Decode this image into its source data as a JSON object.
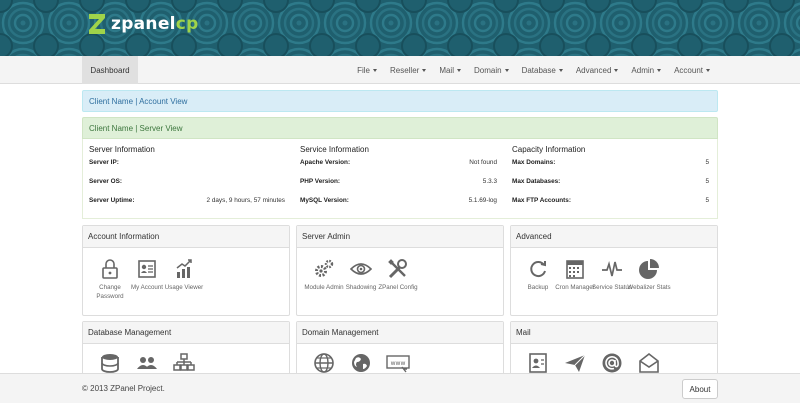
{
  "brand": {
    "name_main": "zpanel",
    "name_accent": "cp"
  },
  "nav": {
    "dashboard": "Dashboard",
    "menus": [
      "File",
      "Reseller",
      "Mail",
      "Domain",
      "Database",
      "Advanced",
      "Admin",
      "Account"
    ]
  },
  "alerts": {
    "client_account": "Client Name | Account View",
    "client_server": "Client Name | Server View"
  },
  "server_info": {
    "title": "Server Information",
    "rows": [
      {
        "label": "Server IP:",
        "value": ""
      },
      {
        "label": "Server OS:",
        "value": ""
      },
      {
        "label": "Server Uptime:",
        "value": "2 days, 9 hours, 57 minutes"
      }
    ]
  },
  "service_info": {
    "title": "Service Information",
    "rows": [
      {
        "label": "Apache Version:",
        "value": "Not found"
      },
      {
        "label": "PHP Version:",
        "value": "5.3.3"
      },
      {
        "label": "MySQL Version:",
        "value": "5.1.69-log"
      }
    ]
  },
  "capacity_info": {
    "title": "Capacity Information",
    "rows": [
      {
        "label": "Max Domains:",
        "value": "5"
      },
      {
        "label": "Max Databases:",
        "value": "5"
      },
      {
        "label": "Max FTP Accounts:",
        "value": "5"
      }
    ]
  },
  "panels": {
    "account": {
      "title": "Account Information",
      "items": [
        {
          "label": "Change Password",
          "icon": "lock-icon"
        },
        {
          "label": "My Account",
          "icon": "id-card-icon"
        },
        {
          "label": "Usage Viewer",
          "icon": "usage-chart-icon"
        }
      ]
    },
    "server_admin": {
      "title": "Server Admin",
      "items": [
        {
          "label": "Module Admin",
          "icon": "gears-icon"
        },
        {
          "label": "Shadowing",
          "icon": "eye-icon"
        },
        {
          "label": "ZPanel Config",
          "icon": "tools-icon"
        }
      ]
    },
    "advanced": {
      "title": "Advanced",
      "items": [
        {
          "label": "Backup",
          "icon": "refresh-icon"
        },
        {
          "label": "Cron Manager",
          "icon": "calendar-icon"
        },
        {
          "label": "Service Status",
          "icon": "pulse-icon"
        },
        {
          "label": "Webalizer Stats",
          "icon": "pie-chart-icon"
        }
      ]
    },
    "database": {
      "title": "Database Management",
      "items": [
        {
          "icon": "database-icon"
        },
        {
          "icon": "users-icon"
        },
        {
          "icon": "hierarchy-icon"
        }
      ]
    },
    "domain": {
      "title": "Domain Management",
      "items": [
        {
          "icon": "globe-icon"
        },
        {
          "icon": "globe-filled-icon"
        },
        {
          "icon": "www-icon"
        }
      ]
    },
    "mail": {
      "title": "Mail",
      "items": [
        {
          "icon": "contact-card-icon"
        },
        {
          "icon": "paper-plane-icon"
        },
        {
          "icon": "at-icon"
        },
        {
          "icon": "envelope-icon"
        }
      ]
    }
  },
  "footer": {
    "copyright": "© 2013 ZPanel Project.",
    "about": "About"
  },
  "colors": {
    "banner": "#1f5f6e",
    "accent": "#9fd34a",
    "info_bg": "#d9edf7",
    "success_bg": "#dff0d8"
  }
}
